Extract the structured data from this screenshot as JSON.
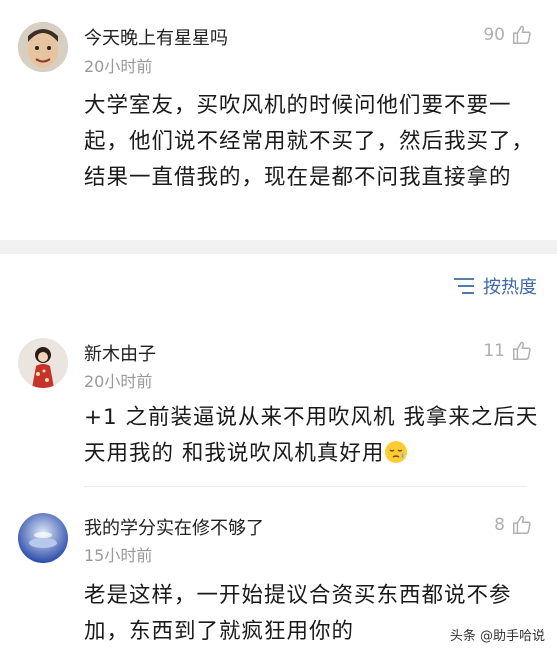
{
  "comments": [
    {
      "username": "今天晚上有星星吗",
      "time": "20小时前",
      "likes": "90",
      "text": "大学室友，买吹风机的时候问他们要不要一起，他们说不经常用就不买了，然后我买了，结果一直借我的，现在是都不问我直接拿的"
    },
    {
      "username": "新木由子",
      "time": "20小时前",
      "likes": "11",
      "text": "+1 之前装逼说从来不用吹风机 我拿来之后天天用我的 和我说吹风机真好用"
    },
    {
      "username": "我的学分实在修不够了",
      "time": "15小时前",
      "likes": "8",
      "text": "老是这样，一开始提议合资买东西都说不参加，东西到了就疯狂用你的"
    }
  ],
  "sort": {
    "label": "按热度",
    "icon": "sort-icon"
  },
  "watermark": "头条 @助手哈说",
  "colors": {
    "accent": "#3e6aa8",
    "muted": "#999999",
    "separator": "#f2f2f2"
  }
}
